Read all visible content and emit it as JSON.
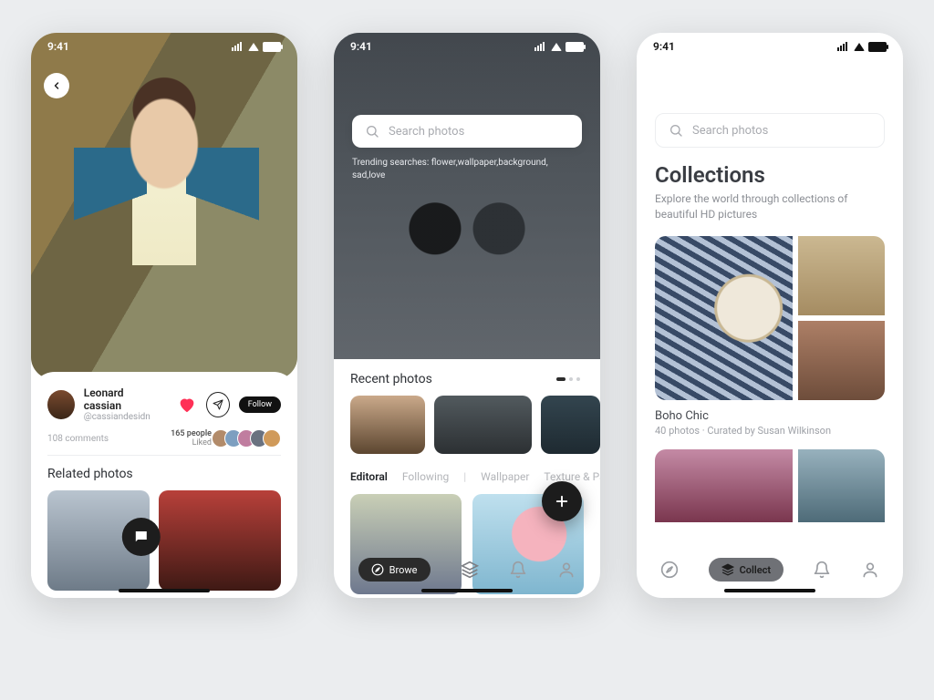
{
  "status": {
    "time": "9:41"
  },
  "screen1": {
    "author": {
      "name": "Leonard cassian",
      "handle": "@cassiandesidn"
    },
    "follow_label": "Follow",
    "comments_label": "108 comments",
    "likes_count": "165 people",
    "likes_label": "Liked",
    "related_heading": "Related photos"
  },
  "screen2": {
    "search_placeholder": "Search photos",
    "trending_text": "Trending searches: flower,wallpaper,background, sad,love",
    "recent_heading": "Recent photos",
    "tabs": {
      "editoral": "Editoral",
      "following": "Following",
      "wallpaper": "Wallpaper",
      "texture": "Texture & Pa"
    },
    "nav": {
      "browse": "Browe"
    }
  },
  "screen3": {
    "search_placeholder": "Search photos",
    "heading": "Collections",
    "subheading": "Explore the world through collections of beautiful HD pictures",
    "collection": {
      "title": "Boho Chic",
      "meta": "40 photos · Curated by Susan Wilkinson"
    },
    "nav": {
      "collect": "Collect"
    }
  }
}
